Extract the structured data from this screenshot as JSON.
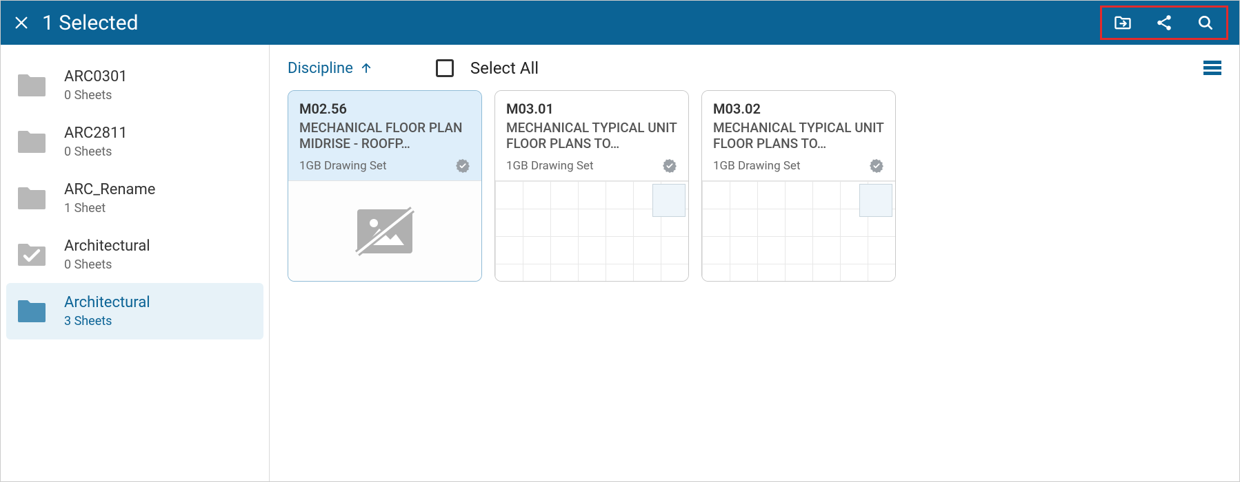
{
  "header": {
    "title": "1 Selected"
  },
  "sort": {
    "label": "Discipline"
  },
  "select_all_label": "Select All",
  "sidebar": {
    "items": [
      {
        "name": "ARC0301",
        "sub": "0 Sheets",
        "type": "folder"
      },
      {
        "name": "ARC2811",
        "sub": "0 Sheets",
        "type": "folder"
      },
      {
        "name": "ARC_Rename",
        "sub": "1 Sheet",
        "type": "folder"
      },
      {
        "name": "Architectural",
        "sub": "0 Sheets",
        "type": "checked"
      },
      {
        "name": "Architectural",
        "sub": "3 Sheets",
        "type": "folder-active"
      }
    ]
  },
  "cards": [
    {
      "id": "M02.56",
      "title": "MECHANICAL FLOOR PLAN MIDRISE - ROOFP…",
      "set": "1GB Drawing Set",
      "selected": true,
      "thumb": "none"
    },
    {
      "id": "M03.01",
      "title": "MECHANICAL TYPICAL UNIT FLOOR PLANS TO…",
      "set": "1GB Drawing Set",
      "selected": false,
      "thumb": "drawing"
    },
    {
      "id": "M03.02",
      "title": "MECHANICAL TYPICAL UNIT FLOOR PLANS TO…",
      "set": "1GB Drawing Set",
      "selected": false,
      "thumb": "drawing"
    }
  ]
}
